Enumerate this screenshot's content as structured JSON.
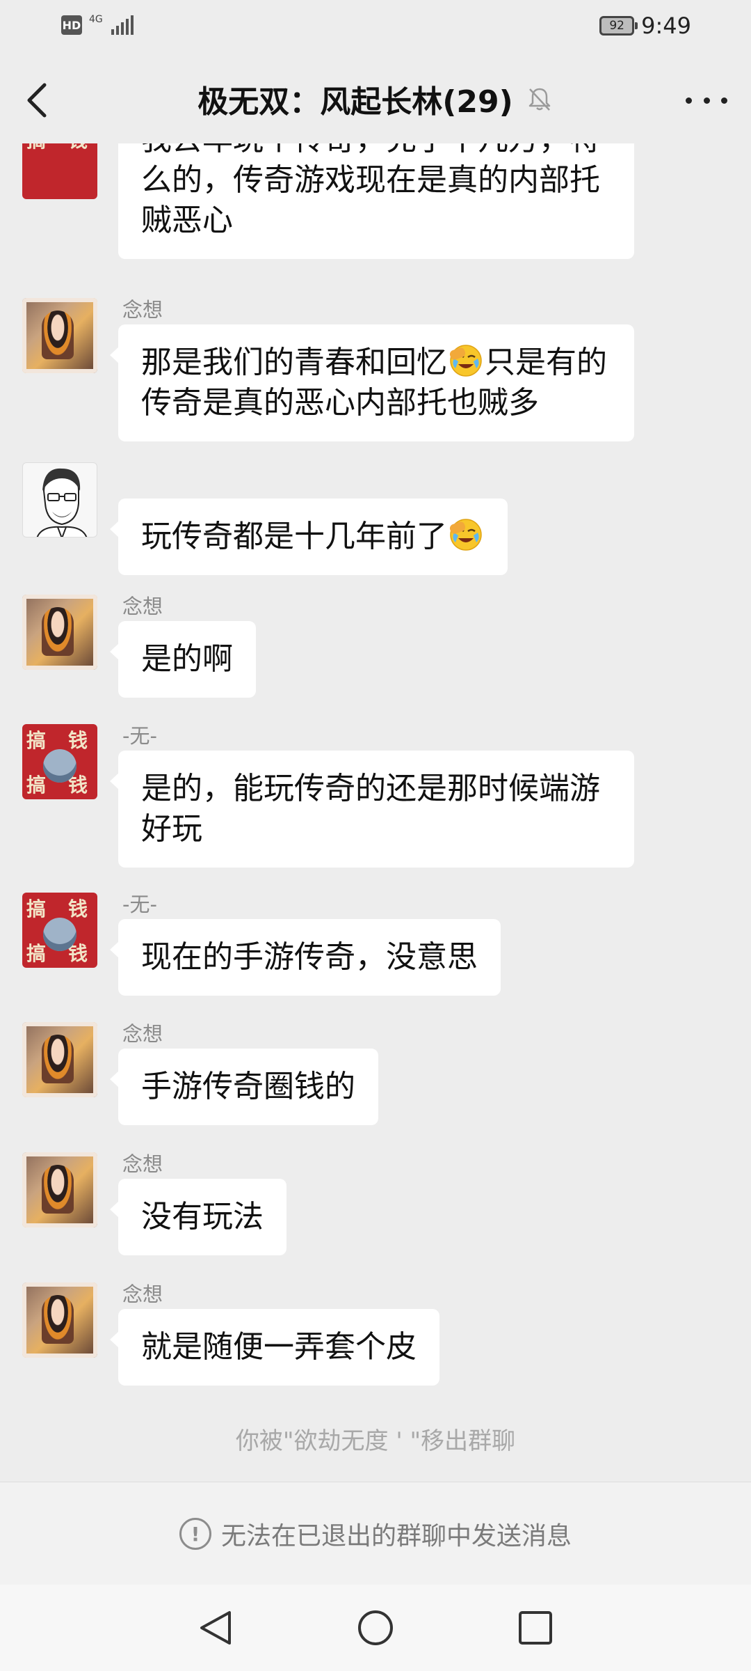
{
  "status_bar": {
    "hd_label": "HD",
    "network_label": "4G",
    "battery_level": "92",
    "time": "9:49"
  },
  "header": {
    "title": "极无双：风起长林(29)",
    "muted": true
  },
  "messages": [
    {
      "sender": "",
      "avatar": "avatar-wu",
      "lines": [
        "我去年玩个传奇，充了十几万，特么的，传奇游戏现在是真的内部托贼恶心"
      ],
      "text": "我去年玩个传奇，充了十几万，特么的，传奇游戏现在是真的内部托贼恶心"
    },
    {
      "sender": "念想",
      "avatar": "avatar-nianxiang",
      "text_before_emoji": "那是我们的青春和回忆",
      "emoji": "facepalm-cry-emoji",
      "text_after_emoji": "只是有的传奇是真的恶心内部托也贼多"
    },
    {
      "sender": "",
      "avatar": "avatar-sketch",
      "text_before_emoji": "玩传奇都是十几年前了",
      "emoji": "facepalm-cry-emoji",
      "text_after_emoji": ""
    },
    {
      "sender": "念想",
      "avatar": "avatar-nianxiang",
      "text": "是的啊"
    },
    {
      "sender": "-无-",
      "avatar": "avatar-wu",
      "text": "是的，能玩传奇的还是那时候端游好玩"
    },
    {
      "sender": "-无-",
      "avatar": "avatar-wu",
      "text": "现在的手游传奇，没意思"
    },
    {
      "sender": "念想",
      "avatar": "avatar-nianxiang",
      "text": "手游传奇圈钱的"
    },
    {
      "sender": "念想",
      "avatar": "avatar-nianxiang",
      "text": "没有玩法"
    },
    {
      "sender": "念想",
      "avatar": "avatar-nianxiang",
      "text": "就是随便一弄套个皮"
    }
  ],
  "system_note": "你被\"欲劫无度 ' \"移出群聊",
  "exited_banner": {
    "icon": "exclamation-circle-icon",
    "text": "无法在已退出的群聊中发送消息"
  },
  "nav_bar": {
    "back_icon": "triangle-back-icon",
    "home_icon": "circle-home-icon",
    "recents_icon": "square-recents-icon"
  },
  "colors": {
    "background": "#ededed",
    "bubble": "#ffffff",
    "sender_name": "#8a8a8a",
    "system_text": "#a8a8a8"
  }
}
